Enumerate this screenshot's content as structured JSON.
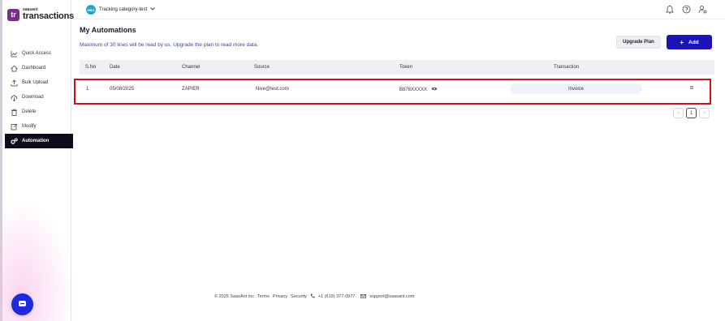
{
  "logo": {
    "mark": "tr",
    "small": "saasant",
    "big": "transactions"
  },
  "sidebar": {
    "items": [
      {
        "label": "Quick Access",
        "icon": "chart-icon"
      },
      {
        "label": "Dashboard",
        "icon": "home-icon"
      },
      {
        "label": "Bulk Upload",
        "icon": "upload-icon"
      },
      {
        "label": "Download",
        "icon": "cloud-download-icon"
      },
      {
        "label": "Delete",
        "icon": "trash-icon"
      },
      {
        "label": "Modify",
        "icon": "edit-icon"
      },
      {
        "label": "Automation",
        "icon": "gears-icon",
        "active": true
      }
    ]
  },
  "topbar": {
    "tenant_avatar": "HBO",
    "tenant_name": "Tracking category-test"
  },
  "main": {
    "title": "My Automations",
    "subtitle": "Maximum of 30 lines will be read by us. Upgrade the plan to read more data.",
    "upgrade_label": "Upgrade Plan",
    "add_label": "Add"
  },
  "table": {
    "headers": [
      "S.No",
      "Date",
      "Channel",
      "Source",
      "Token",
      "Transaction"
    ],
    "rows": [
      {
        "sno": "1",
        "date": "05/08/2025",
        "channel": "ZAPIER",
        "source": "Nive@test.com",
        "token": "B878XXXXX",
        "transaction": "Invoice"
      }
    ]
  },
  "pagination": {
    "current": "1",
    "prev": "‹",
    "next": "›"
  },
  "footer": {
    "copyright": "© 2025 SaasAnt Inc",
    "terms": "Terms",
    "privacy": "Privacy",
    "security": "Security",
    "phone": "+1 (619) 377-0977",
    "email": "support@saasant.com"
  },
  "colors": {
    "accent": "#1b13b8",
    "highlight": "#c8141d",
    "sidebar_active": "#0d0d1a",
    "brand": "#7b2d8e"
  }
}
